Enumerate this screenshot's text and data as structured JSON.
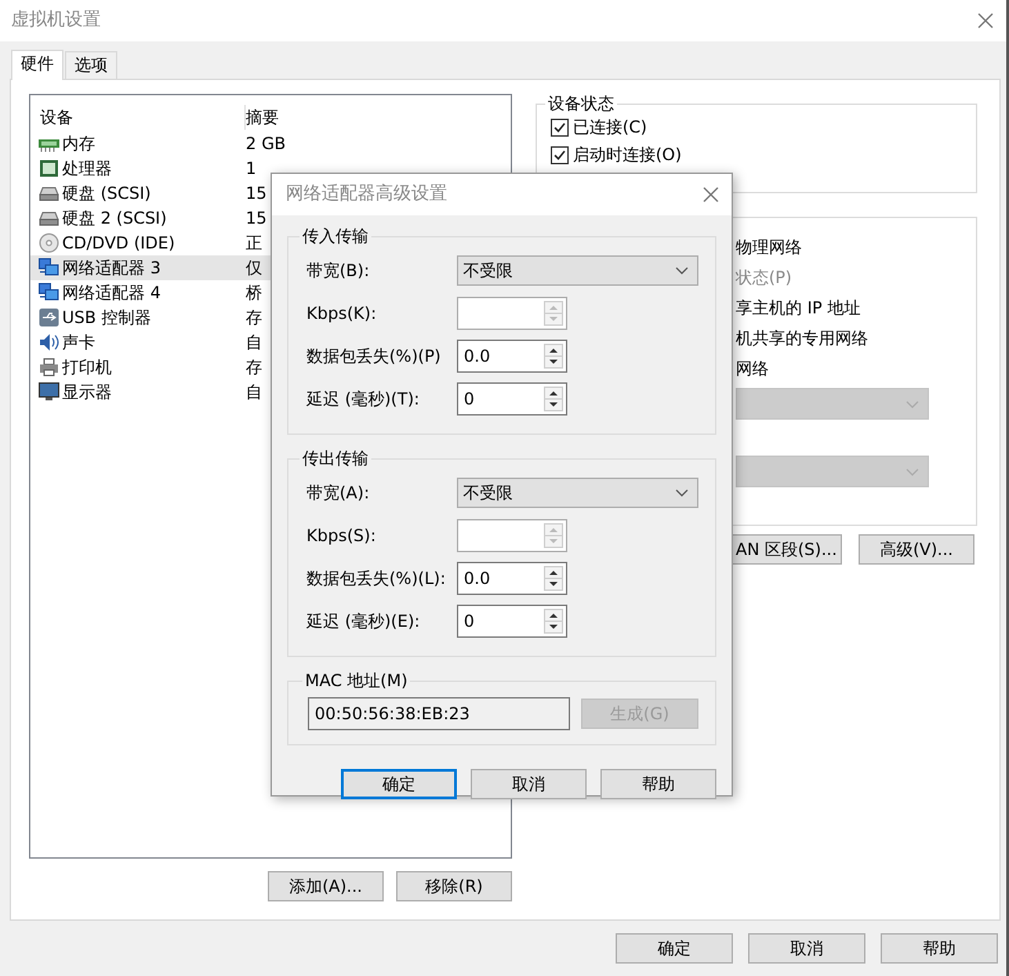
{
  "window": {
    "title": "虚拟机设置"
  },
  "tabs": [
    {
      "label": "硬件",
      "selected": true
    },
    {
      "label": "选项",
      "selected": false
    }
  ],
  "devices": {
    "columns": [
      "设备",
      "摘要"
    ],
    "rows": [
      {
        "kind": "memory",
        "name": "内存",
        "summary": "2 GB",
        "selected": false
      },
      {
        "kind": "cpu",
        "name": "处理器",
        "summary": "1",
        "selected": false
      },
      {
        "kind": "disk",
        "name": "硬盘 (SCSI)",
        "summary": "15",
        "selected": false
      },
      {
        "kind": "disk",
        "name": "硬盘 2 (SCSI)",
        "summary": "15",
        "selected": false
      },
      {
        "kind": "cd",
        "name": "CD/DVD (IDE)",
        "summary": "正",
        "selected": false
      },
      {
        "kind": "network",
        "name": "网络适配器 3",
        "summary": "仅",
        "selected": true
      },
      {
        "kind": "network",
        "name": "网络适配器 4",
        "summary": "桥",
        "selected": false
      },
      {
        "kind": "usb",
        "name": "USB 控制器",
        "summary": "存",
        "selected": false
      },
      {
        "kind": "sound",
        "name": "声卡",
        "summary": "自",
        "selected": false
      },
      {
        "kind": "printer",
        "name": "打印机",
        "summary": "存",
        "selected": false
      },
      {
        "kind": "display",
        "name": "显示器",
        "summary": "自",
        "selected": false
      }
    ]
  },
  "device_buttons": [
    "添加(A)...",
    "移除(R)"
  ],
  "device_status": {
    "title": "设备状态",
    "checkboxes": [
      {
        "label": "已连接(C)",
        "checked": true
      },
      {
        "label": "启动时连接(O)",
        "checked": true
      }
    ]
  },
  "network_connection": {
    "lines": [
      {
        "text": "物理网络",
        "disabled": false
      },
      {
        "text": "状态(P)",
        "disabled": true
      },
      {
        "text": "享主机的 IP 地址",
        "disabled": false
      },
      {
        "text": "机共享的专用网络",
        "disabled": false
      },
      {
        "text": "网络",
        "disabled": false
      }
    ],
    "dropdowns": [
      {
        "disabled": true
      },
      {
        "disabled": true
      }
    ]
  },
  "network_buttons": [
    "AN 区段(S)...",
    "高级(V)..."
  ],
  "buttons": [
    "确定",
    "取消",
    "帮助"
  ],
  "dialog": {
    "title": "网络适配器高级设置",
    "groups": [
      {
        "title": "传入传输",
        "rows": [
          {
            "kind": "select",
            "label": "带宽(B):",
            "value": "不受限"
          },
          {
            "kind": "spin",
            "label": "Kbps(K):",
            "disabled": true
          },
          {
            "kind": "spin",
            "label": "数据包丢失(%)(P)",
            "value": "0.0",
            "disabled": false
          },
          {
            "kind": "spin",
            "label": "延迟 (毫秒)(T):",
            "value": "0",
            "disabled": false
          }
        ]
      },
      {
        "title": "传出传输",
        "rows": [
          {
            "kind": "select",
            "label": "带宽(A):",
            "value": "不受限"
          },
          {
            "kind": "spin",
            "label": "Kbps(S):",
            "disabled": true
          },
          {
            "kind": "spin",
            "label": "数据包丢失(%)(L):",
            "value": "0.0",
            "disabled": false
          },
          {
            "kind": "spin",
            "label": "延迟 (毫秒)(E):",
            "value": "0",
            "disabled": false
          }
        ]
      }
    ],
    "mac": {
      "title": "MAC 地址(M)",
      "value": "00:50:56:38:EB:23",
      "button": {
        "label": "生成(G)",
        "disabled": true
      }
    },
    "buttons": [
      {
        "label": "确定",
        "default": true
      },
      {
        "label": "取消",
        "default": false
      },
      {
        "label": "帮助",
        "default": false
      }
    ]
  }
}
